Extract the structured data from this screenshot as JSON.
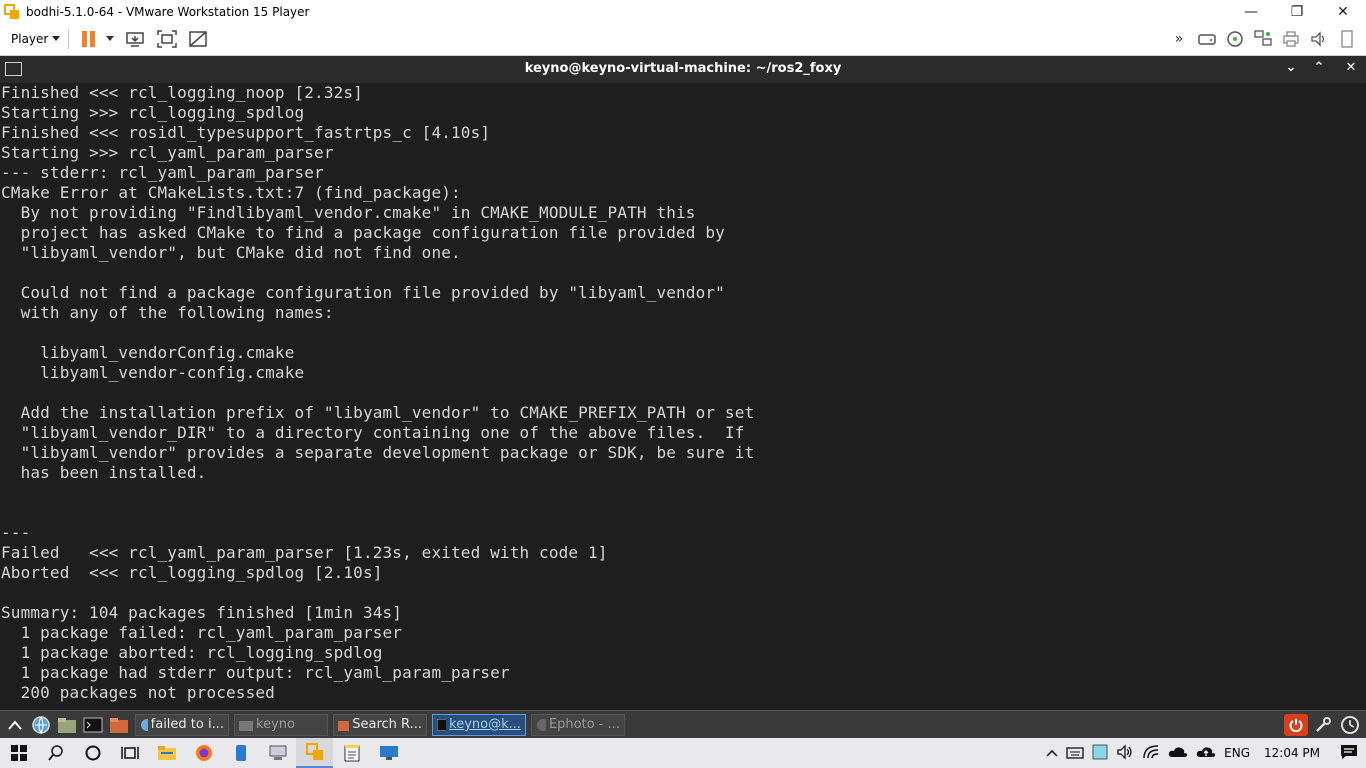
{
  "vm_window": {
    "title": "bodhi-5.1.0-64 - VMware Workstation 15 Player",
    "controls": {
      "minimize": "—",
      "maximize": "❐",
      "close": "✕"
    }
  },
  "vm_toolbar": {
    "player_menu_label": "Player",
    "left_icons": [
      "pause-icon",
      "dropdown-icon",
      "send-ctrl-alt-del-icon",
      "fullscreen-icon",
      "unity-icon"
    ],
    "right_icons": [
      "more-icon",
      "hard-disk-icon",
      "cd-drive-icon",
      "network-adapter-icon",
      "printer-icon",
      "sound-icon",
      "usb-icon"
    ],
    "accent_color": "#f0832a"
  },
  "terminal": {
    "title": "keyno@keyno-virtual-machine: ~/ros2_foxy",
    "lines": [
      "Finished <<< rcl_logging_noop [2.32s]",
      "Starting >>> rcl_logging_spdlog",
      "Finished <<< rosidl_typesupport_fastrtps_c [4.10s]",
      "Starting >>> rcl_yaml_param_parser",
      "--- stderr: rcl_yaml_param_parser",
      "CMake Error at CMakeLists.txt:7 (find_package):",
      "  By not providing \"Findlibyaml_vendor.cmake\" in CMAKE_MODULE_PATH this",
      "  project has asked CMake to find a package configuration file provided by",
      "  \"libyaml_vendor\", but CMake did not find one.",
      "",
      "  Could not find a package configuration file provided by \"libyaml_vendor\"",
      "  with any of the following names:",
      "",
      "    libyaml_vendorConfig.cmake",
      "    libyaml_vendor-config.cmake",
      "",
      "  Add the installation prefix of \"libyaml_vendor\" to CMAKE_PREFIX_PATH or set",
      "  \"libyaml_vendor_DIR\" to a directory containing one of the above files.  If",
      "  \"libyaml_vendor\" provides a separate development package or SDK, be sure it",
      "  has been installed.",
      "",
      "",
      "---",
      "Failed   <<< rcl_yaml_param_parser [1.23s, exited with code 1]",
      "Aborted  <<< rcl_logging_spdlog [2.10s]",
      "",
      "Summary: 104 packages finished [1min 34s]",
      "  1 package failed: rcl_yaml_param_parser",
      "  1 package aborted: rcl_logging_spdlog",
      "  1 package had stderr output: rcl_yaml_param_parser",
      "  200 packages not processed"
    ]
  },
  "bodhi_taskbar": {
    "launchers": [
      "menu-up-icon",
      "browser-icon",
      "files-icon",
      "terminal-icon",
      "folder-icon"
    ],
    "tasks": [
      {
        "label": "failed to i...",
        "icon": "web-icon",
        "state": "normal"
      },
      {
        "label": "keyno",
        "icon": "folder-icon",
        "state": "dim"
      },
      {
        "label": "Search R...",
        "icon": "folder-icon",
        "state": "normal"
      },
      {
        "label": "keyno@k...",
        "icon": "terminal-icon",
        "state": "active"
      },
      {
        "label": "Ephoto - ...",
        "icon": "photo-icon",
        "state": "dim"
      }
    ],
    "system_icons": [
      "power-icon",
      "tools-icon",
      "clock-icon"
    ]
  },
  "windows_taskbar": {
    "apps": [
      "windows-start-icon",
      "search-icon",
      "cortana-icon",
      "task-view-icon",
      "file-explorer-icon",
      "firefox-icon",
      "phone-icon",
      "network-share-icon",
      "vmware-icon",
      "notepad-icon",
      "remote-desktop-icon"
    ],
    "tray": {
      "language": "ENG",
      "time": "12:04 PM"
    }
  }
}
